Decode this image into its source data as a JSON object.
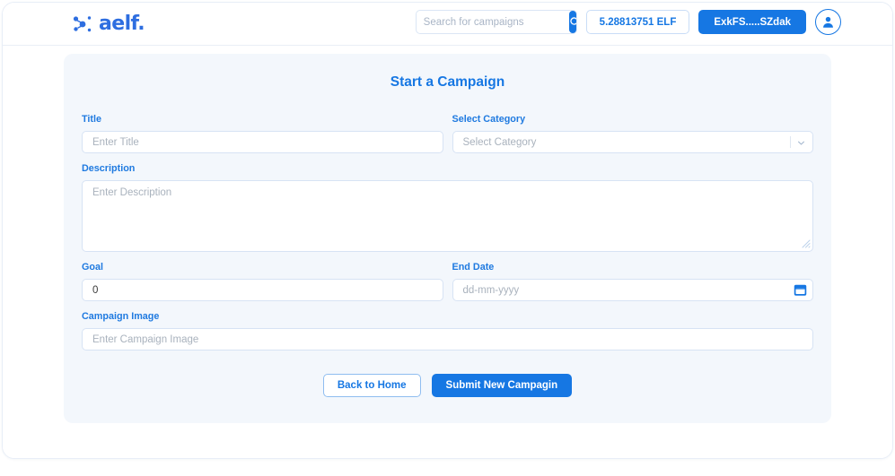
{
  "colors": {
    "brand_blue": "#1677e3",
    "label_blue": "#1f7ae0",
    "card_bg": "#f3f7fc",
    "input_border": "#d7e3f4",
    "placeholder": "#a9b2bd"
  },
  "header": {
    "logo_icon": "aelf-dots-icon",
    "logo_text": "aelf.",
    "search": {
      "placeholder": "Search for campaigns",
      "value": "",
      "button_icon": "search-icon"
    },
    "balance_label": "5.28813751 ELF",
    "wallet_address_label": "ExkFS.....SZdak",
    "avatar_icon": "user-avatar-icon"
  },
  "form": {
    "title": "Start a Campaign",
    "fields": {
      "title": {
        "label": "Title",
        "placeholder": "Enter Title",
        "value": ""
      },
      "category": {
        "label": "Select Category",
        "selected": "Select Category",
        "caret_icon": "chevron-down-icon"
      },
      "description": {
        "label": "Description",
        "placeholder": "Enter Description",
        "value": ""
      },
      "goal": {
        "label": "Goal",
        "placeholder": "0",
        "value": "0"
      },
      "end_date": {
        "label": "End Date",
        "placeholder": "dd-mm-yyyy",
        "value": "",
        "icon": "calendar-icon"
      },
      "campaign_image": {
        "label": "Campaign Image",
        "placeholder": "Enter Campaign Image",
        "value": ""
      }
    },
    "actions": {
      "back_label": "Back to Home",
      "submit_label": "Submit New Campagin"
    }
  }
}
